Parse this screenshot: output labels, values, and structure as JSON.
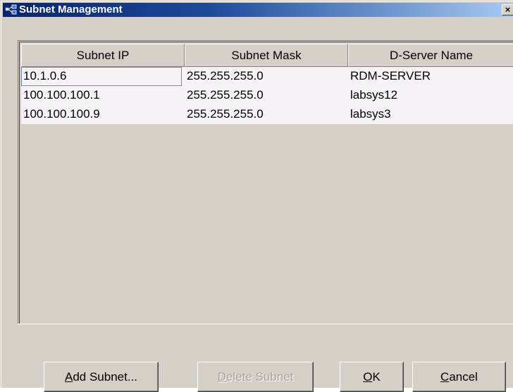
{
  "window": {
    "title": "Subnet Management",
    "close_glyph": "×"
  },
  "table": {
    "columns": [
      "Subnet IP",
      "Subnet Mask",
      "D-Server Name"
    ],
    "rows": [
      [
        "10.1.0.6",
        "255.255.255.0",
        "RDM-SERVER"
      ],
      [
        "100.100.100.1",
        "255.255.255.0",
        "labsys12"
      ],
      [
        "100.100.100.9",
        "255.255.255.0",
        "labsys3"
      ]
    ],
    "selected_cell": "10.1.0.6"
  },
  "buttons": {
    "add_subnet": {
      "mnemonic": "A",
      "rest": "dd Subnet...",
      "enabled": true
    },
    "delete_subnet": {
      "mnemonic": "D",
      "rest": "elete Subnet",
      "enabled": false
    },
    "ok": {
      "mnemonic": "O",
      "rest": "K",
      "enabled": true
    },
    "cancel": {
      "mnemonic": "C",
      "rest": "ancel",
      "enabled": true
    }
  },
  "icons": {
    "title_icon": "network-icon",
    "close_icon": "close-icon"
  },
  "colors": {
    "titlebar_start": "#0a246a",
    "titlebar_end": "#a6caf0",
    "dialog_face": "#d4d0c8",
    "row_background": "#f5f3f5",
    "disabled_text": "#a8a49c"
  }
}
